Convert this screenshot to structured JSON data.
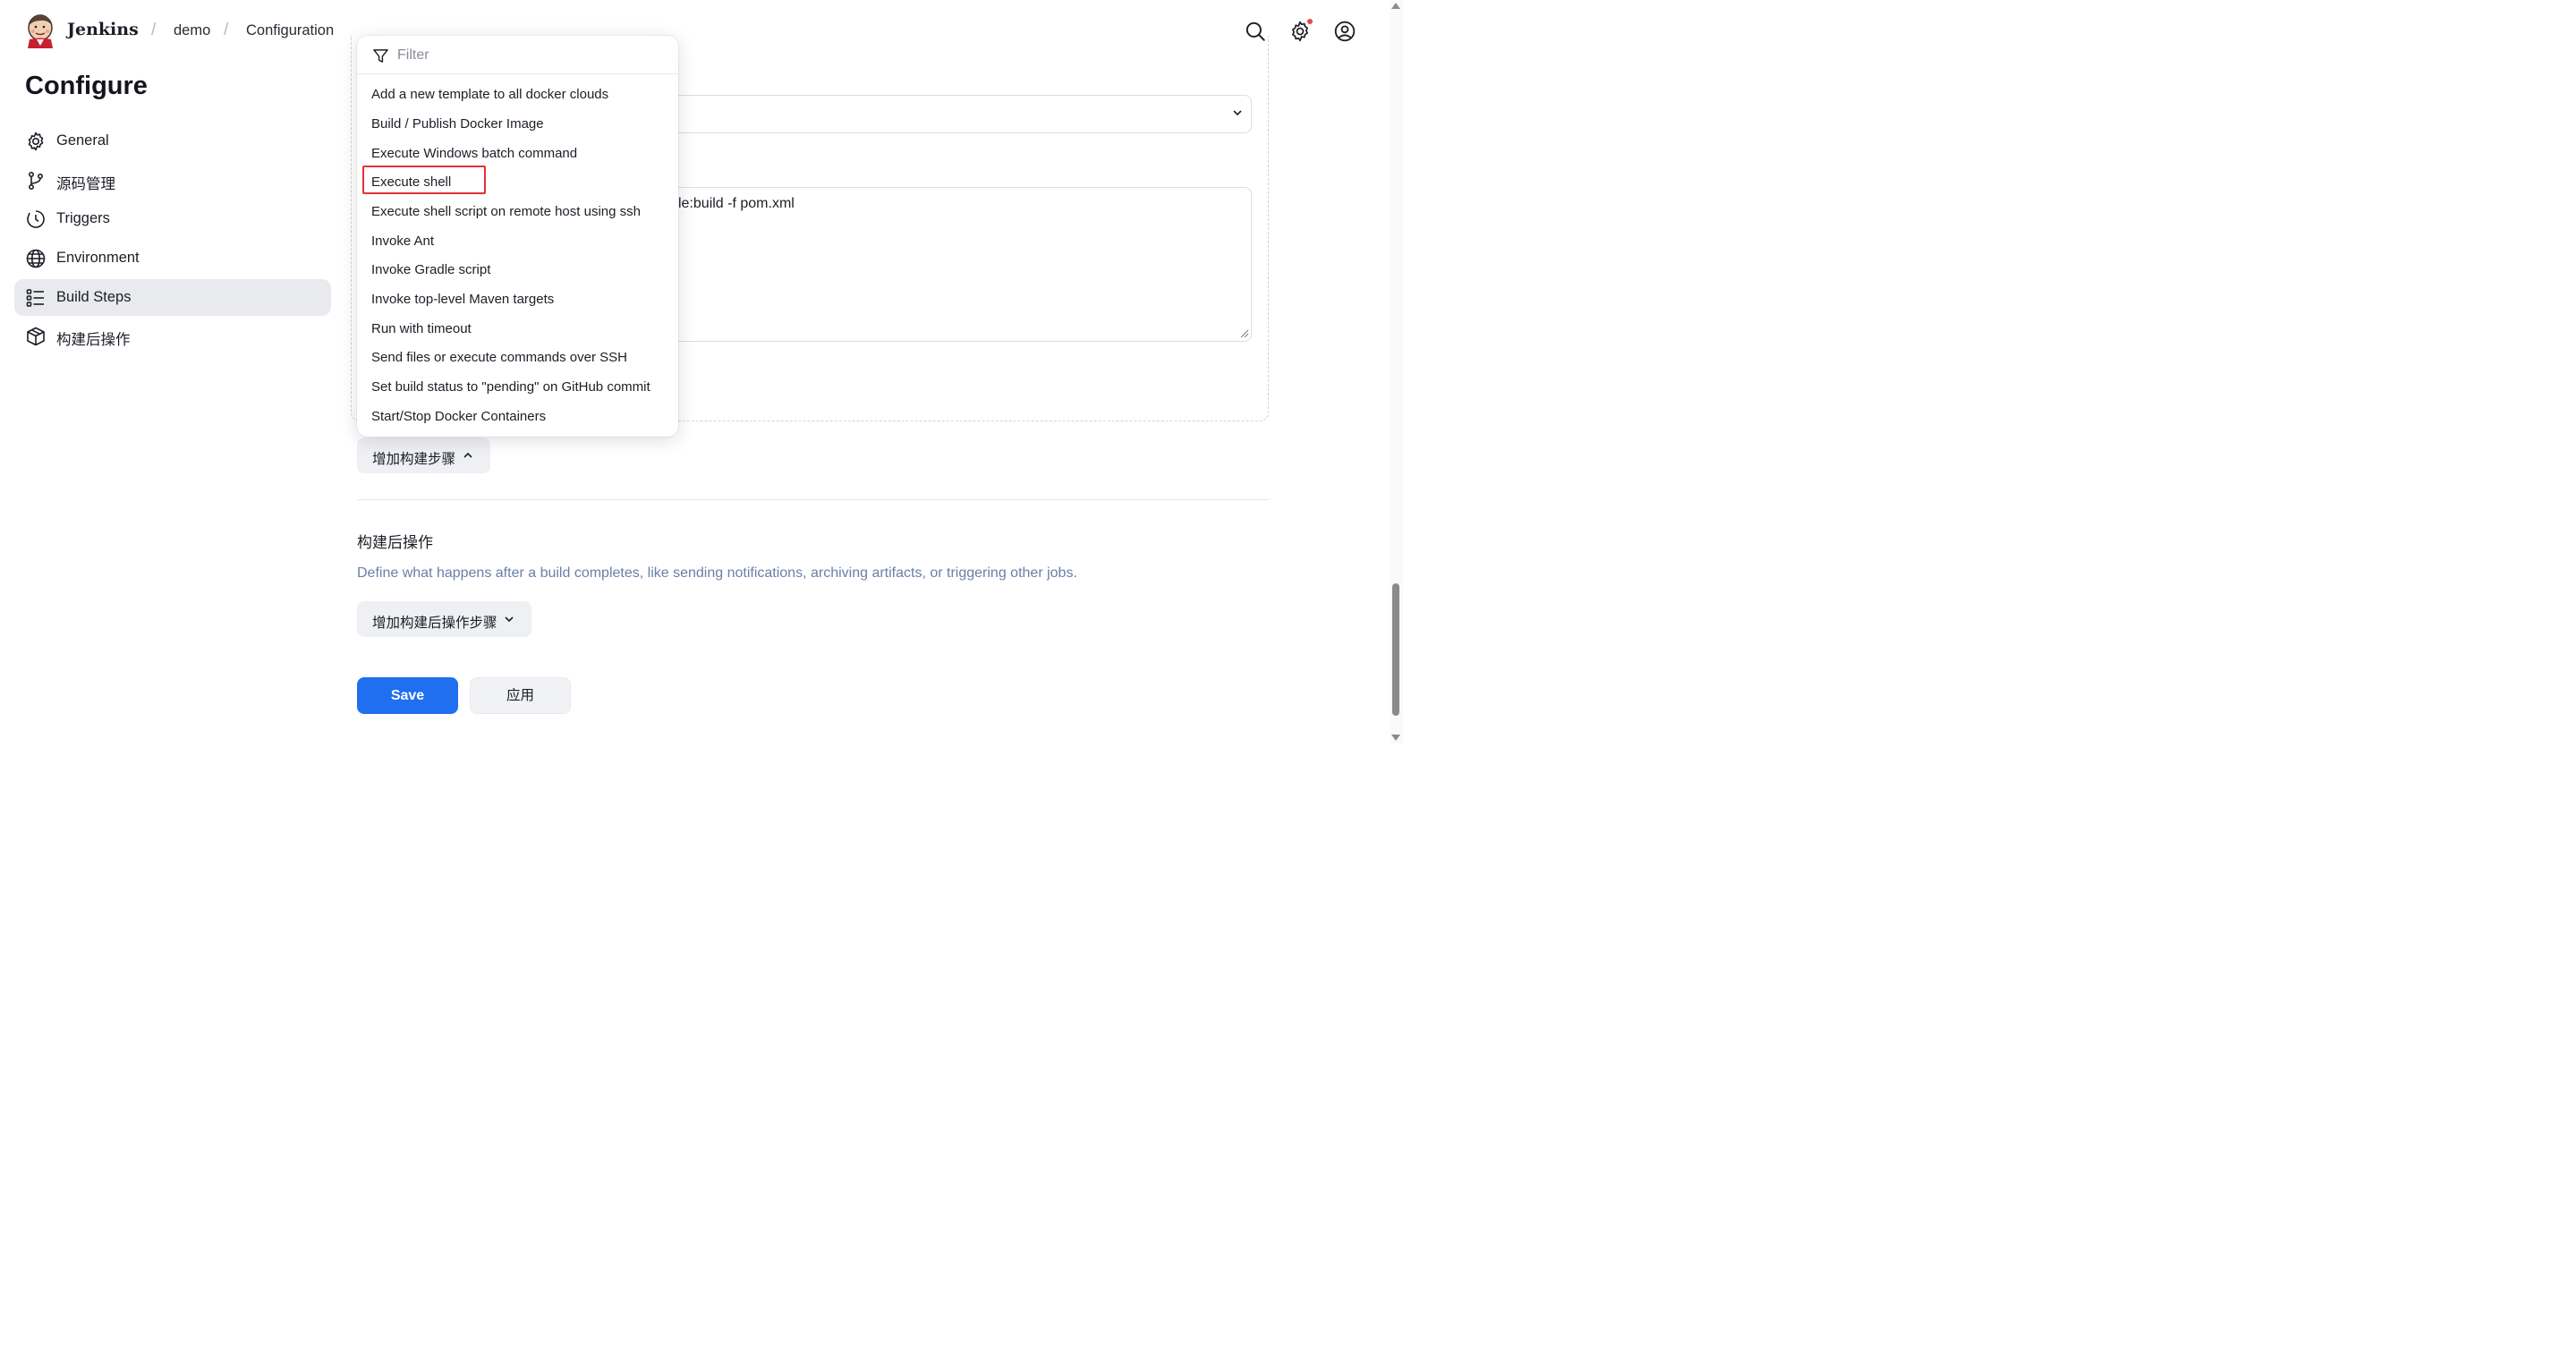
{
  "header": {
    "brand": "Jenkins",
    "breadcrumb": [
      "demo",
      "Configuration"
    ],
    "separator": "/",
    "icons": [
      "search-icon",
      "settings-icon",
      "user-icon"
    ],
    "notification_color": "#e5484d"
  },
  "sidebar": {
    "title": "Configure",
    "items": [
      {
        "label": "General",
        "icon": "gear-icon"
      },
      {
        "label": "源码管理",
        "icon": "branch-icon"
      },
      {
        "label": "Triggers",
        "icon": "clock-icon"
      },
      {
        "label": "Environment",
        "icon": "globe-icon"
      },
      {
        "label": "Build Steps",
        "icon": "list-icon",
        "active": true
      },
      {
        "label": "构建后操作",
        "icon": "package-icon"
      }
    ]
  },
  "dropdown": {
    "filter_placeholder": "Filter",
    "items": [
      "Add a new template to all docker clouds",
      "Build / Publish Docker Image",
      "Execute Windows batch command",
      "Execute shell",
      "Execute shell script on remote host using ssh",
      "Invoke Ant",
      "Invoke Gradle script",
      "Invoke top-level Maven targets",
      "Run with timeout",
      "Send files or execute commands over SSH",
      "Set build status to \"pending\" on GitHub commit",
      "Start/Stop Docker Containers"
    ],
    "highlighted": "Execute shell",
    "highlight_color": "#e5303a"
  },
  "main": {
    "command_text": "le:build -f pom.xml",
    "add_build_step": "增加构建步骤",
    "post_build": {
      "title": "构建后操作",
      "description": "Define what happens after a build completes, like sending notifications, archiving artifacts, or triggering other jobs.",
      "add_button": "增加构建后操作步骤"
    },
    "save": "Save",
    "apply": "应用",
    "accent_color": "#1f6ff0"
  }
}
